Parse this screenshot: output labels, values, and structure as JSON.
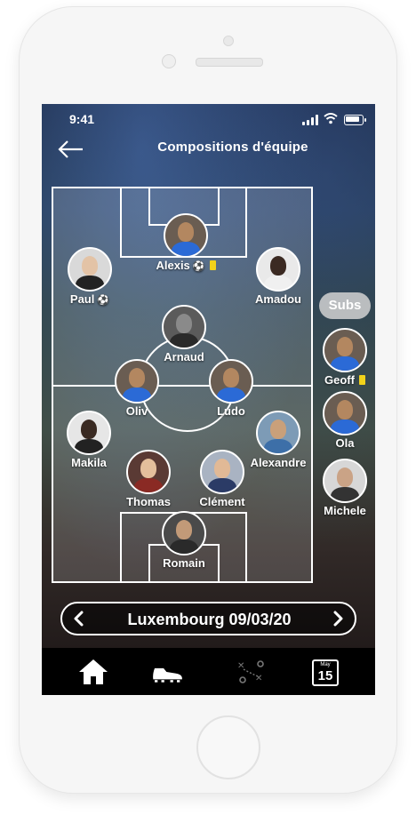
{
  "status_bar": {
    "time": "9:41"
  },
  "header": {
    "title": "Compositions d'équipe",
    "back_icon": "arrow-left-icon"
  },
  "lineup": [
    {
      "id": "alexis",
      "name": "Alexis",
      "ball": "⚽",
      "yellow_card": true,
      "skin": "#b38760",
      "shirt": "#2b6ad6"
    },
    {
      "id": "paul",
      "name": "Paul",
      "ball": "⚽",
      "yellow_card": false,
      "skin": "#e3c3a6",
      "shirt": "#222222"
    },
    {
      "id": "amadou",
      "name": "Amadou",
      "ball": "",
      "yellow_card": false,
      "skin": "#3b2a22",
      "shirt": "#f0f0f0"
    },
    {
      "id": "arnaud",
      "name": "Arnaud",
      "ball": "",
      "yellow_card": false,
      "skin": "#8a8a8a",
      "shirt": "#2a2a2a"
    },
    {
      "id": "oliv",
      "name": "Oliv",
      "ball": "",
      "yellow_card": false,
      "skin": "#b38760",
      "shirt": "#2b6ad6"
    },
    {
      "id": "ludo",
      "name": "Ludo",
      "ball": "",
      "yellow_card": false,
      "skin": "#b38760",
      "shirt": "#2b6ad6"
    },
    {
      "id": "makila",
      "name": "Makila",
      "ball": "",
      "yellow_card": false,
      "skin": "#3a2a22",
      "shirt": "#222222"
    },
    {
      "id": "alexandre",
      "name": "Alexandre",
      "ball": "",
      "yellow_card": false,
      "skin": "#c9a07a",
      "shirt": "#3d6fa8"
    },
    {
      "id": "thomas",
      "name": "Thomas",
      "ball": "",
      "yellow_card": false,
      "skin": "#e4bf9c",
      "shirt": "#8a2a24"
    },
    {
      "id": "clement",
      "name": "Clément",
      "ball": "",
      "yellow_card": false,
      "skin": "#e1b996",
      "shirt": "#2b3b66"
    },
    {
      "id": "romain",
      "name": "Romain",
      "ball": "",
      "yellow_card": false,
      "skin": "#c29a78",
      "shirt": "#2a2a2a"
    }
  ],
  "subs": {
    "label": "Subs",
    "players": [
      {
        "id": "geoff",
        "name": "Geoff",
        "yellow_card": true,
        "skin": "#b38760",
        "shirt": "#2b6ad6"
      },
      {
        "id": "ola",
        "name": "Ola",
        "yellow_card": false,
        "skin": "#b38760",
        "shirt": "#2b6ad6"
      },
      {
        "id": "michele",
        "name": "Michele",
        "yellow_card": false,
        "skin": "#caa386",
        "shirt": "#333333"
      }
    ]
  },
  "match_selector": {
    "label": "Luxembourg 09/03/20",
    "prev_icon": "chevron-left-icon",
    "next_icon": "chevron-right-icon"
  },
  "tab_bar": {
    "items": [
      {
        "id": "home",
        "icon": "home-icon"
      },
      {
        "id": "boots",
        "icon": "football-boot-icon"
      },
      {
        "id": "tactics",
        "icon": "tactics-board-icon"
      },
      {
        "id": "calendar",
        "icon": "calendar-icon",
        "calendar_month": "May",
        "calendar_day": "15"
      }
    ]
  },
  "colors": {
    "yellow_card": "#f2d21a",
    "pitch_line": "#ffffff",
    "tab_bar": "#000000"
  }
}
